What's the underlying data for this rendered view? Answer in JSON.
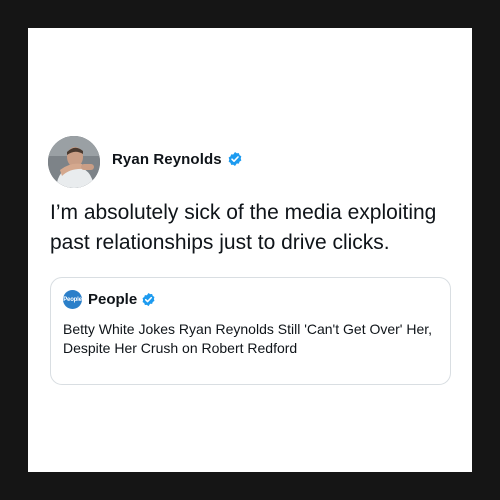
{
  "tweet": {
    "author": {
      "name": "Ryan Reynolds",
      "verified": true,
      "avatar_icon": "profile-photo"
    },
    "text": "I’m absolutely sick of the media exploiting past relationships just to drive clicks.",
    "quoted": {
      "logo_text": "People",
      "name": "People",
      "verified": true,
      "text": "Betty White Jokes Ryan Reynolds Still 'Can't Get Over' Her, Despite Her Crush on Robert Redford"
    }
  },
  "colors": {
    "background_frame": "#151515",
    "card": "#ffffff",
    "text": "#0f1419",
    "verified_badge": "#1d9bf0",
    "quote_border": "#d9dee2",
    "people_logo": "#2b7fc9"
  }
}
